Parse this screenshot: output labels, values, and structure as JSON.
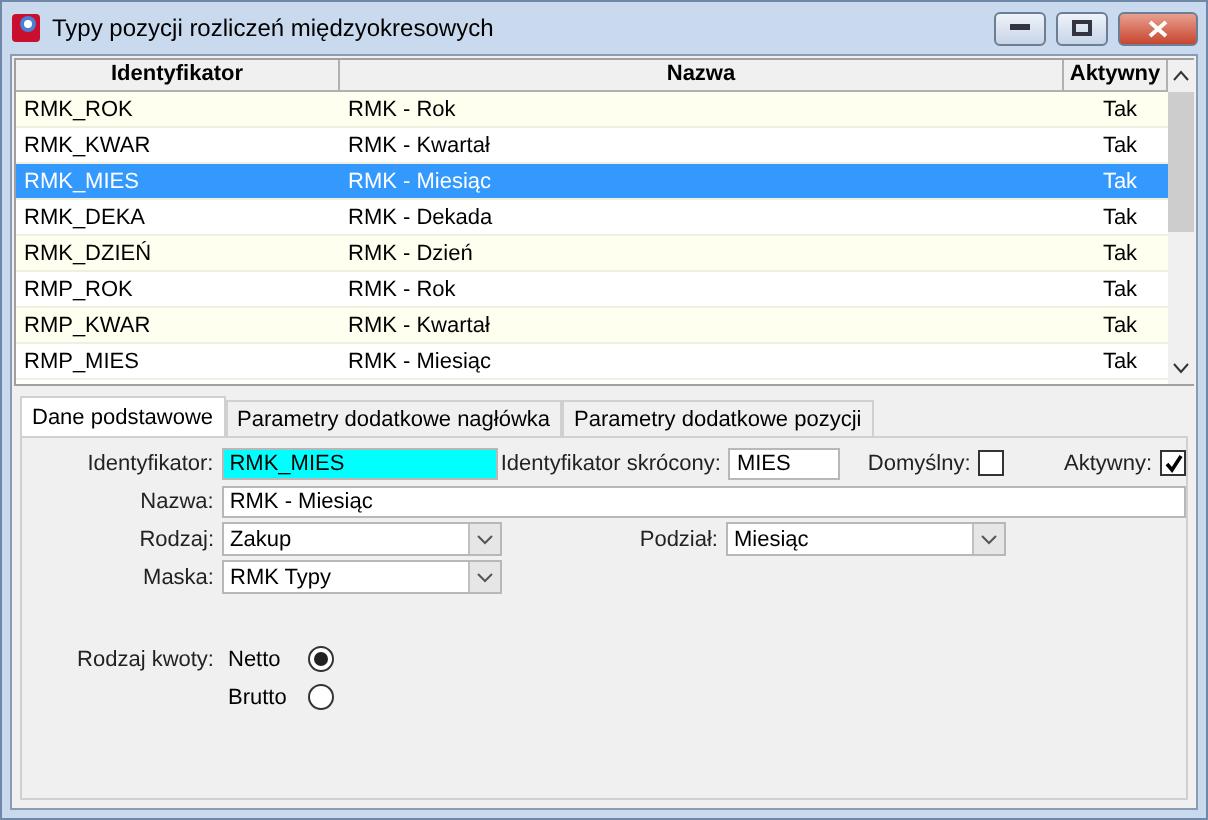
{
  "window": {
    "title": "Typy pozycji rozliczeń międzyokresowych"
  },
  "table": {
    "columns": [
      "Identyfikator",
      "Nazwa",
      "Aktywny"
    ],
    "rows": [
      {
        "cells": [
          "RMK_ROK",
          "RMK - Rok",
          "Tak"
        ],
        "selected": false
      },
      {
        "cells": [
          "RMK_KWAR",
          "RMK - Kwartał",
          "Tak"
        ],
        "selected": false
      },
      {
        "cells": [
          "RMK_MIES",
          "RMK - Miesiąc",
          "Tak"
        ],
        "selected": true
      },
      {
        "cells": [
          "RMK_DEKA",
          "RMK - Dekada",
          "Tak"
        ],
        "selected": false
      },
      {
        "cells": [
          "RMK_DZIEŃ",
          "RMK - Dzień",
          "Tak"
        ],
        "selected": false
      },
      {
        "cells": [
          "RMP_ROK",
          "RMK - Rok",
          "Tak"
        ],
        "selected": false
      },
      {
        "cells": [
          "RMP_KWAR",
          "RMK - Kwartał",
          "Tak"
        ],
        "selected": false
      },
      {
        "cells": [
          "RMP_MIES",
          "RMK - Miesiąc",
          "Tak"
        ],
        "selected": false
      }
    ]
  },
  "tabs": [
    {
      "label": "Dane podstawowe",
      "selected": true
    },
    {
      "label": "Parametry dodatkowe nagłówka",
      "selected": false
    },
    {
      "label": "Parametry dodatkowe pozycji",
      "selected": false
    }
  ],
  "form": {
    "identifier": {
      "label": "Identyfikator:",
      "value": "RMK_MIES"
    },
    "short_identifier": {
      "label": "Identyfikator skrócony:",
      "value": "MIES"
    },
    "default": {
      "label": "Domyślny:",
      "checked": false
    },
    "active": {
      "label": "Aktywny:",
      "checked": true
    },
    "name": {
      "label": "Nazwa:",
      "value": "RMK - Miesiąc"
    },
    "type": {
      "label": "Rodzaj:",
      "value": "Zakup"
    },
    "split": {
      "label": "Podział:",
      "value": "Miesiąc"
    },
    "mask": {
      "label": "Maska:",
      "value": "RMK Typy"
    },
    "amount_type": {
      "label": "Rodzaj kwoty:",
      "options": [
        {
          "label": "Netto",
          "selected": true
        },
        {
          "label": "Brutto",
          "selected": false
        }
      ]
    }
  }
}
